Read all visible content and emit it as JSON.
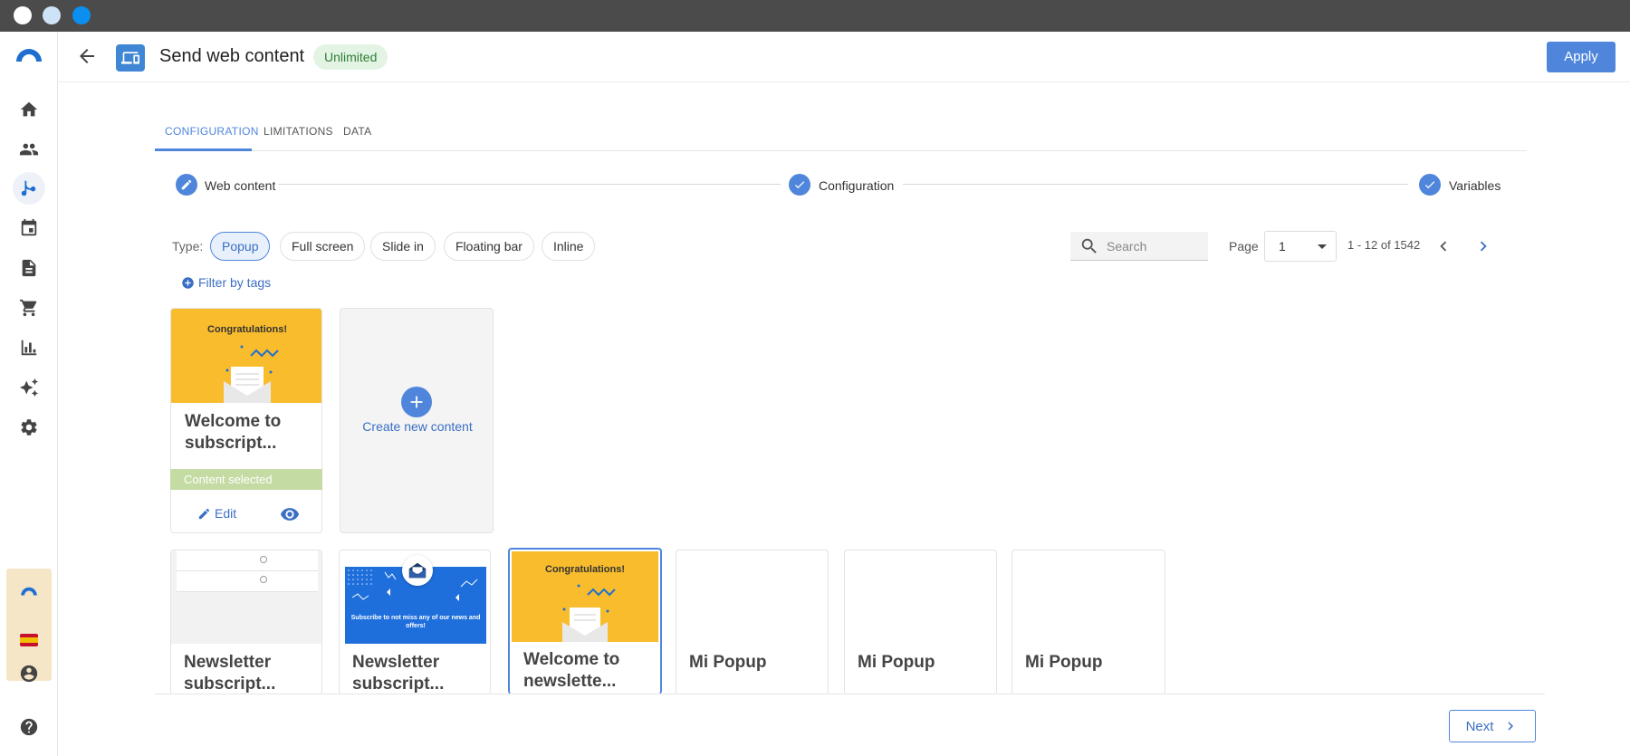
{
  "window": {
    "traffic_lights": [
      "#ffffff",
      "#cfe3f8",
      "#0a8ef0"
    ]
  },
  "sidebar": {
    "items": [
      {
        "icon": "home-icon"
      },
      {
        "icon": "people-icon"
      },
      {
        "icon": "flow-icon",
        "active": true
      },
      {
        "icon": "calendar-icon"
      },
      {
        "icon": "document-icon"
      },
      {
        "icon": "cart-icon"
      },
      {
        "icon": "bar-chart-icon"
      },
      {
        "icon": "sparkle-icon"
      },
      {
        "icon": "gear-icon"
      }
    ],
    "bottom": [
      {
        "icon": "account-icon"
      },
      {
        "icon": "help-icon"
      }
    ]
  },
  "header": {
    "title": "Send web content",
    "badge": "Unlimited",
    "apply_label": "Apply"
  },
  "tabs": [
    {
      "label": "CONFIGURATION",
      "active": true
    },
    {
      "label": "LIMITATIONS"
    },
    {
      "label": "DATA"
    }
  ],
  "stepper": {
    "steps": [
      {
        "label": "Web content",
        "icon": "pencil-icon"
      },
      {
        "label": "Configuration",
        "icon": "check-icon"
      },
      {
        "label": "Variables",
        "icon": "check-icon"
      }
    ]
  },
  "filters": {
    "type_label": "Type:",
    "types": [
      {
        "label": "Popup",
        "active": true
      },
      {
        "label": "Full screen"
      },
      {
        "label": "Slide in"
      },
      {
        "label": "Floating bar"
      },
      {
        "label": "Inline"
      }
    ],
    "filter_by_tags": "Filter by tags",
    "search_placeholder": "Search",
    "page_label": "Page",
    "page_value": "1",
    "range": "1 - 12 of 1542"
  },
  "cards_row1": {
    "selected_card": {
      "thumb_heading": "Congratulations!",
      "title_line1": "Welcome to",
      "title_line2": "subscript...",
      "selected_label": "Content selected",
      "edit_label": "Edit"
    },
    "create_card": {
      "label": "Create new content"
    }
  },
  "cards_row2": [
    {
      "title_line1": "Newsletter",
      "title_line2": "subscript...",
      "thumb": "table"
    },
    {
      "title_line1": "Newsletter",
      "title_line2": "subscript...",
      "thumb": "blue",
      "thumb_text": "Subscribe to not miss any of our news and offers!"
    },
    {
      "title_line1": "Welcome to",
      "title_line2": "newslette...",
      "thumb": "yellow",
      "thumb_heading": "Congratulations!",
      "highlighted": true
    },
    {
      "title_line1": "Mi Popup",
      "title_line2": ""
    },
    {
      "title_line1": "Mi Popup",
      "title_line2": ""
    },
    {
      "title_line1": "Mi Popup",
      "title_line2": ""
    }
  ],
  "footer": {
    "next_label": "Next"
  },
  "colors": {
    "accent": "#4f86db",
    "thumb_yellow": "#f8bc2d",
    "thumb_blue": "#1e6fdc",
    "selected_green": "#c5dba4"
  }
}
